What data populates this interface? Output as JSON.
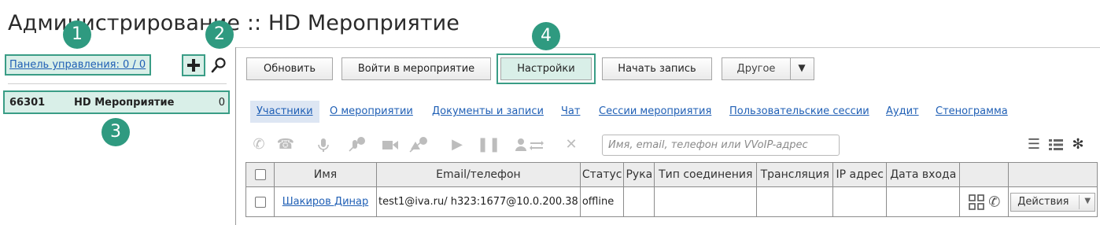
{
  "page": {
    "title": "Администрирование :: HD Мероприятие"
  },
  "markers": [
    "1",
    "2",
    "3",
    "4"
  ],
  "left_panel": {
    "dashboard_link": "Панель управления: 0 / 0",
    "events": [
      {
        "id": "66301",
        "name": "HD Мероприятие",
        "count": "0"
      }
    ]
  },
  "toolbar": {
    "refresh": "Обновить",
    "enter_event": "Войти в мероприятие",
    "settings": "Настройки",
    "start_record": "Начать запись",
    "other": "Другое"
  },
  "tabs": [
    "Участники",
    "О мероприятии",
    "Документы и записи",
    "Чат",
    "Сессии мероприятия",
    "Пользовательские сессии",
    "Аудит",
    "Стенограмма"
  ],
  "search": {
    "placeholder": "Имя, email, телефон или VVoIP-адрес"
  },
  "table": {
    "columns": [
      "Имя",
      "Email/телефон",
      "Статус",
      "Рука",
      "Тип соединения",
      "Трансляция",
      "IP адрес",
      "Дата входа"
    ],
    "rows": [
      {
        "name": "Шакиров Динар",
        "contact": "test1@iva.ru/ h323:1677@10.0.200.38",
        "status": "offline",
        "hand": "",
        "connection": "",
        "broadcast": "",
        "ip": "",
        "login_date": "",
        "actions": "Действия"
      }
    ]
  },
  "colors": {
    "accent": "#2f9a80",
    "highlight_bg": "#d9efe8",
    "link": "#1f5fb5"
  }
}
